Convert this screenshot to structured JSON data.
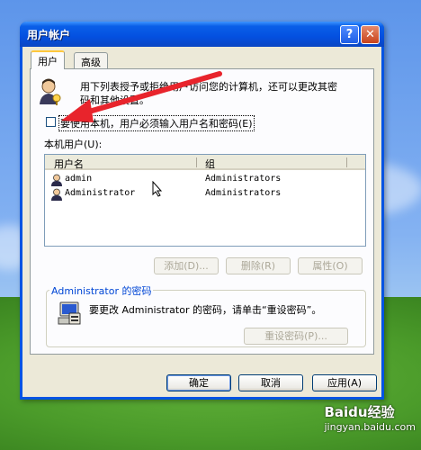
{
  "window": {
    "title": "用户帐户",
    "help_button": "?",
    "close_button": "✕"
  },
  "tabs": [
    {
      "label": "用户",
      "active": true
    },
    {
      "label": "高级",
      "active": false
    }
  ],
  "intro_text_line1": "用下列表授予或拒绝用户访问您的计算机，还可以更改其密",
  "intro_text_line2": "码和其他设置。",
  "require_password_checkbox": {
    "label": "要使用本机，用户必须输入用户名和密码(E)",
    "checked": false
  },
  "users_label": "本机用户(U):",
  "users_table": {
    "columns": [
      "用户名",
      "组"
    ],
    "rows": [
      {
        "name": "admin",
        "group": "Administrators"
      },
      {
        "name": "Administrator",
        "group": "Administrators"
      }
    ]
  },
  "list_buttons": {
    "add": "添加(D)...",
    "remove": "删除(R)",
    "properties": "属性(O)"
  },
  "password_group": {
    "title": "Administrator 的密码",
    "text": "要更改 Administrator 的密码，请单击“重设密码”。",
    "reset_button": "重设密码(P)..."
  },
  "footer_buttons": {
    "ok": "确定",
    "cancel": "取消",
    "apply": "应用(A)"
  },
  "watermark": {
    "brand": "Baidu经验",
    "url": "jingyan.baidu.com"
  },
  "colors": {
    "titlebar": "#0450e0",
    "window_bg": "#ece9d8",
    "tab_highlight": "#ffc83c",
    "group_title": "#0046d5",
    "arrow": "#e8242c"
  }
}
